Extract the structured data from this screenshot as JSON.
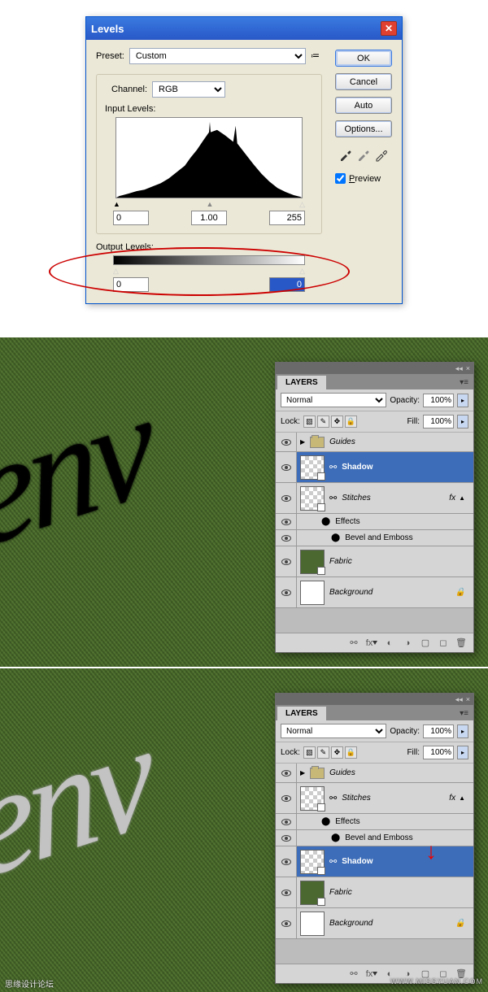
{
  "levels": {
    "title": "Levels",
    "preset_label": "Preset:",
    "preset_value": "Custom",
    "channel_label": "Channel:",
    "channel_value": "RGB",
    "input_label": "Input Levels:",
    "input_black": "0",
    "input_mid": "1.00",
    "input_white": "255",
    "output_label": "Output Levels:",
    "output_black": "0",
    "output_white": "0",
    "buttons": {
      "ok": "OK",
      "cancel": "Cancel",
      "auto": "Auto",
      "options": "Options..."
    },
    "preview_checked": true,
    "preview_label": "Preview"
  },
  "panel1": {
    "tab": "LAYERS",
    "blend_mode": "Normal",
    "opacity_label": "Opacity:",
    "opacity_value": "100%",
    "lock_label": "Lock:",
    "fill_label": "Fill:",
    "fill_value": "100%",
    "layers": {
      "guides": "Guides",
      "shadow": "Shadow",
      "stitches": "Stitches",
      "effects": "Effects",
      "bevel": "Bevel and Emboss",
      "fabric": "Fabric",
      "background": "Background",
      "fx": "fx"
    }
  },
  "panel2": {
    "tab": "LAYERS",
    "blend_mode": "Normal",
    "opacity_label": "Opacity:",
    "opacity_value": "100%",
    "lock_label": "Lock:",
    "fill_label": "Fill:",
    "fill_value": "100%",
    "layers": {
      "guides": "Guides",
      "stitches": "Stitches",
      "effects": "Effects",
      "bevel": "Bevel and Emboss",
      "shadow": "Shadow",
      "fabric": "Fabric",
      "background": "Background",
      "fx": "fx"
    }
  },
  "canvas_text": "env",
  "watermark": {
    "left": "思缘设计论坛",
    "right": "WWW.MISSYUAN.COM"
  }
}
